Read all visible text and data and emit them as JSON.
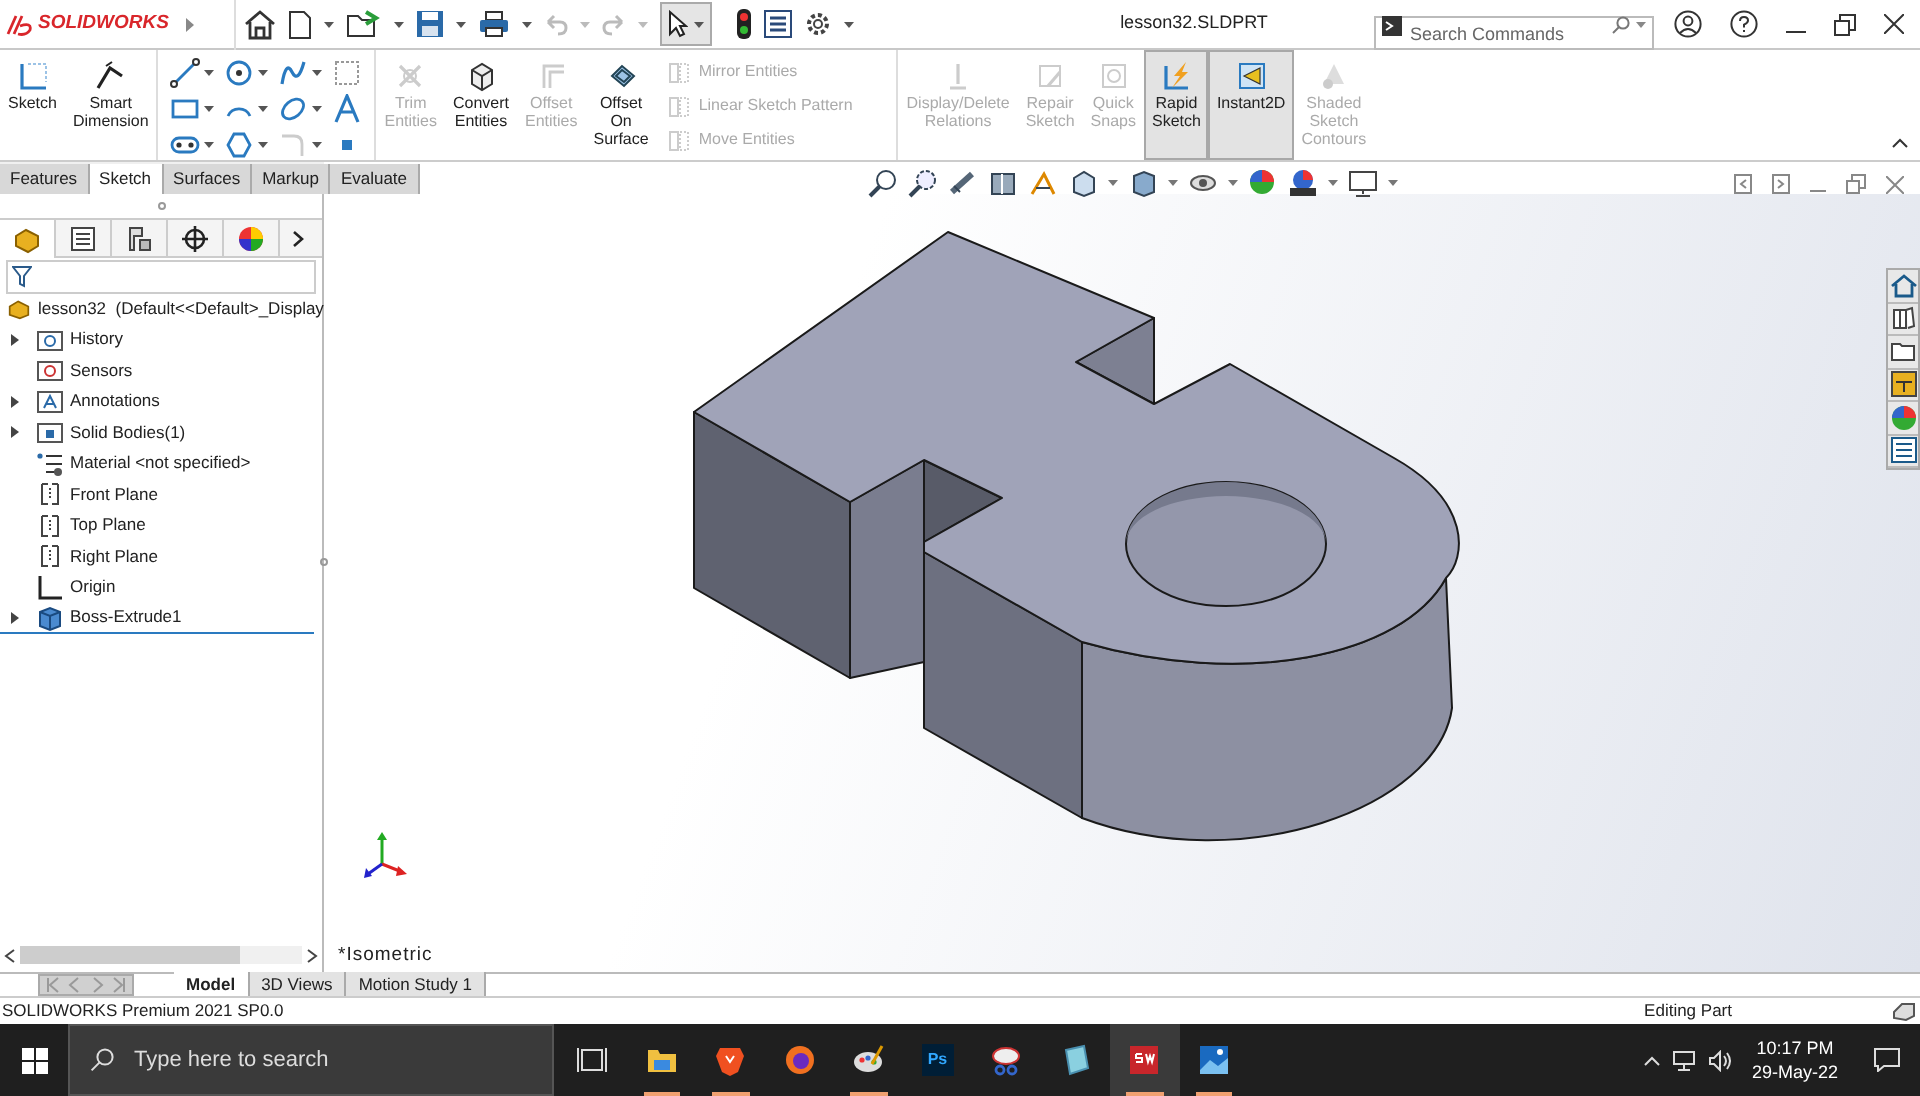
{
  "title_bar": {
    "app_name": "SOLIDWORKS",
    "title": "lesson32.SLDPRT",
    "search": {
      "placeholder": "Search Commands"
    }
  },
  "ribbon": [
    {
      "kind": "large",
      "label": "Sketch",
      "disabled": false,
      "pressed": false
    },
    {
      "kind": "large",
      "label": "Smart Dimension",
      "disabled": false,
      "pressed": false
    },
    {
      "kind": "tools"
    },
    {
      "kind": "large",
      "label": "Trim Entities",
      "disabled": true,
      "pressed": false
    },
    {
      "kind": "large",
      "label": "Convert Entities",
      "disabled": false,
      "pressed": false
    },
    {
      "kind": "large",
      "label": "Offset Entities",
      "disabled": true,
      "pressed": false
    },
    {
      "kind": "large",
      "label": "Offset On Surface",
      "disabled": false,
      "pressed": false
    },
    {
      "kind": "list",
      "entries": [
        {
          "label": "Mirror Entities",
          "disabled": true
        },
        {
          "label": "Linear Sketch Pattern",
          "disabled": true
        },
        {
          "label": "Move Entities",
          "disabled": true
        }
      ]
    },
    {
      "kind": "large",
      "label": "Display/Delete Relations",
      "disabled": true,
      "pressed": false
    },
    {
      "kind": "large",
      "label": "Repair Sketch",
      "disabled": true,
      "pressed": false
    },
    {
      "kind": "large",
      "label": "Quick Snaps",
      "disabled": true,
      "pressed": false
    },
    {
      "kind": "large",
      "label": "Rapid Sketch",
      "disabled": false,
      "pressed": true
    },
    {
      "kind": "large",
      "label": "Instant2D",
      "disabled": false,
      "pressed": true
    },
    {
      "kind": "large",
      "label": "Shaded Sketch Contours",
      "disabled": true,
      "pressed": false
    }
  ],
  "tabs": [
    {
      "label": "Features",
      "selected": false
    },
    {
      "label": "Sketch",
      "selected": true
    },
    {
      "label": "Surfaces",
      "selected": false
    },
    {
      "label": "Markup",
      "selected": false
    },
    {
      "label": "Evaluate",
      "selected": false
    }
  ],
  "feature_tree": {
    "root": "lesson32  (Default<<Default>_Display",
    "items": [
      {
        "kind": "history",
        "label": "History",
        "expanded": false
      },
      {
        "kind": "sensors",
        "label": "Sensors"
      },
      {
        "kind": "annotations",
        "label": "Annotations",
        "expanded": false
      },
      {
        "kind": "bodies",
        "label": "Solid Bodies(1)",
        "expanded": false
      },
      {
        "kind": "material",
        "label": "Material <not specified>"
      },
      {
        "kind": "plane",
        "label": "Front Plane"
      },
      {
        "kind": "plane",
        "label": "Top Plane"
      },
      {
        "kind": "plane",
        "label": "Right Plane"
      },
      {
        "kind": "origin",
        "label": "Origin"
      },
      {
        "kind": "feature",
        "label": "Boss-Extrude1",
        "expanded": false
      }
    ]
  },
  "viewport": {
    "view_label": "*Isometric"
  },
  "bottom_tabs": [
    {
      "label": "Model",
      "selected": true
    },
    {
      "label": "3D Views",
      "selected": false
    },
    {
      "label": "Motion Study 1",
      "selected": false
    }
  ],
  "status_bar": {
    "left": "SOLIDWORKS Premium 2021 SP0.0",
    "right": "Editing Part"
  },
  "taskbar": {
    "search": {
      "placeholder": "Type here to search"
    },
    "apps": [
      {
        "kind": "taskview",
        "running": false
      },
      {
        "kind": "explorer",
        "running": true
      },
      {
        "kind": "brave",
        "running": true
      },
      {
        "kind": "firefox",
        "running": false
      },
      {
        "kind": "paint",
        "running": true
      },
      {
        "kind": "photoshop",
        "label": "Ps",
        "running": false
      },
      {
        "kind": "snip",
        "running": false
      },
      {
        "kind": "notes",
        "running": false
      },
      {
        "kind": "solidworks",
        "running": true
      },
      {
        "kind": "photos",
        "running": true
      }
    ],
    "time": "10:17 PM",
    "date": "29-May-22"
  }
}
